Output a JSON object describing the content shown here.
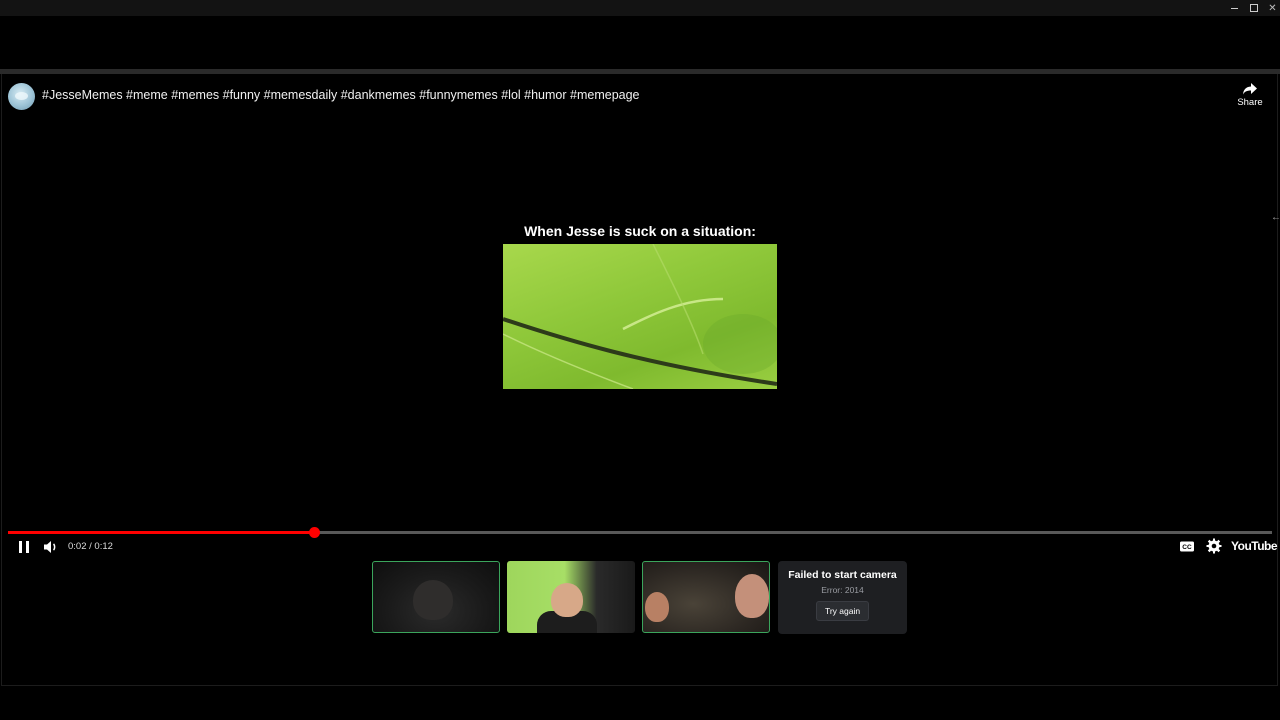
{
  "window": {
    "controls": [
      "minimize",
      "maximize",
      "close"
    ]
  },
  "video": {
    "title": "#JesseMemes #meme #memes #funny #memesdaily #dankmemes #funnymemes #lol #humor #memepage",
    "share_label": "Share",
    "caption": "When Jesse is suck on a situation:",
    "progress_fraction": 0.242,
    "time_display": "0:02 / 0:12",
    "brand_label": "YouTube",
    "colors": {
      "progress": "#ff0000",
      "background": "#000000"
    }
  },
  "call": {
    "tiles": [
      {
        "id": "participant-1",
        "speaking": true
      },
      {
        "id": "participant-2",
        "speaking": false
      },
      {
        "id": "participant-3",
        "speaking": true
      }
    ],
    "camera_error": {
      "title": "Failed to start camera",
      "subtitle": "Error: 2014",
      "button_label": "Try again"
    },
    "colors": {
      "speaking_border": "#3ba55c",
      "panel": "#1e1f22"
    }
  }
}
